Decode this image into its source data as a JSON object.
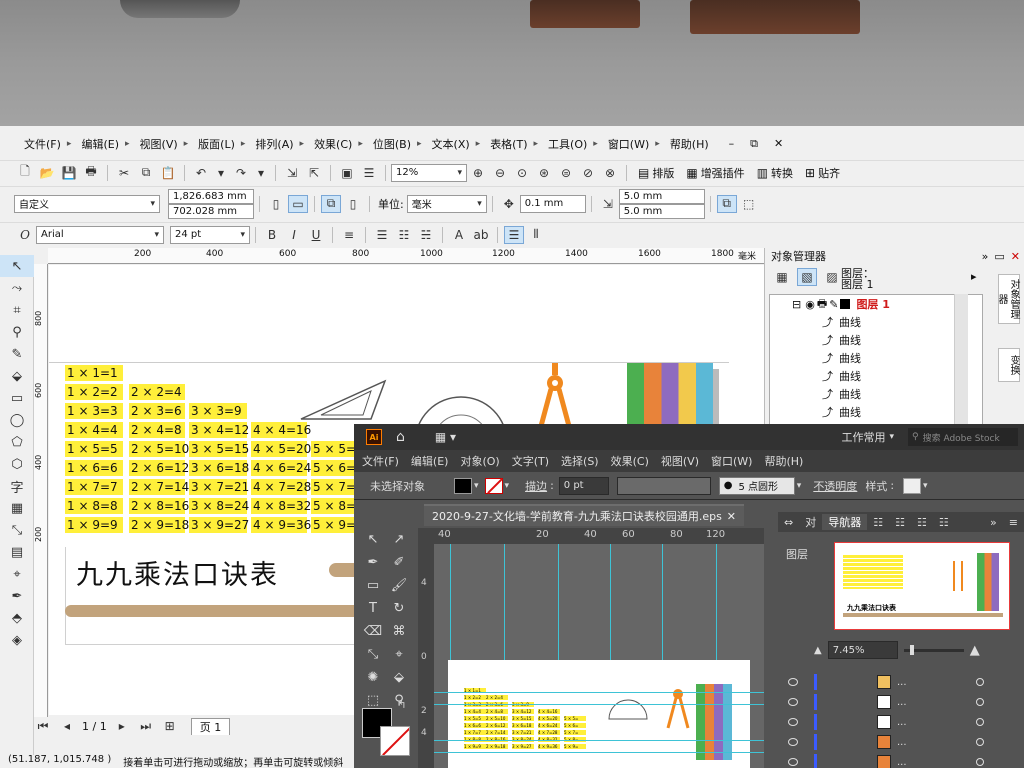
{
  "corel": {
    "menu": [
      "文件(F)",
      "编辑(E)",
      "视图(V)",
      "版面(L)",
      "排列(A)",
      "效果(C)",
      "位图(B)",
      "文本(X)",
      "表格(T)",
      "工具(O)",
      "窗口(W)",
      "帮助(H)"
    ],
    "window_controls": [
      "–",
      "⧉",
      "✕"
    ],
    "zoom": "12%",
    "toolbar_buttons": {
      "layout": "排版",
      "plugin": "增强插件",
      "convert": "转换",
      "together": "贴齐"
    },
    "page_preset": "自定义",
    "width": "1,826.683 mm",
    "height": "702.028 mm",
    "unit_label": "单位:",
    "unit": "毫米",
    "nudge": "0.1 mm",
    "dup_x": "5.0 mm",
    "dup_y": "5.0 mm",
    "font": "Arial",
    "font_size": "24 pt",
    "hruler_unit": "毫米",
    "hruler_ticks": [
      "200",
      "400",
      "600",
      "800",
      "1000",
      "1200",
      "1400",
      "1600",
      "1800"
    ],
    "vruler_ticks": [
      "800",
      "600",
      "400",
      "200"
    ],
    "page_nav": {
      "position": "1 / 1",
      "tab": "页 1"
    },
    "status": {
      "coords": "(51.187, 1,015.748 )",
      "hint": "接着单击可进行拖动或缩放；再单击可旋转或倾斜"
    },
    "object_manager": {
      "title": "对象管理器",
      "layer_label": "图层：",
      "layer_name": "图层 1",
      "layer_header": "图层 1",
      "items": [
        "曲线",
        "曲线",
        "曲线",
        "曲线",
        "曲线",
        "曲线"
      ],
      "side_tab": "对象管理器",
      "side_tab2": "变换"
    }
  },
  "artwork": {
    "table": [
      [
        "1 × 1=1"
      ],
      [
        "1 × 2=2",
        "2 × 2=4"
      ],
      [
        "1 × 3=3",
        "2 × 3=6",
        "3 × 3=9"
      ],
      [
        "1 × 4=4",
        "2 × 4=8",
        "3 × 4=12",
        "4 × 4=16"
      ],
      [
        "1 × 5=5",
        "2 × 5=10",
        "3 × 5=15",
        "4 × 5=20",
        "5 × 5="
      ],
      [
        "1 × 6=6",
        "2 × 6=12",
        "3 × 6=18",
        "4 × 6=24",
        "5 × 6="
      ],
      [
        "1 × 7=7",
        "2 × 7=14",
        "3 × 7=21",
        "4 × 7=28",
        "5 × 7="
      ],
      [
        "1 × 8=8",
        "2 × 8=16",
        "3 × 8=24",
        "4 × 8=32",
        "5 × 8="
      ],
      [
        "1 × 9=9",
        "2 × 9=18",
        "3 × 9=27",
        "4 × 9=36",
        "5 × 9="
      ]
    ],
    "title": "九九乘法口诀表",
    "colors": {
      "highlight": "#ffef3a",
      "shelf": "#c2a37c",
      "compass": "#f0891f"
    }
  },
  "illustrator": {
    "logo": "Ai",
    "workspace": "工作常用",
    "search_placeholder": "搜索 Adobe Stock",
    "menu": [
      "文件(F)",
      "编辑(E)",
      "对象(O)",
      "文字(T)",
      "选择(S)",
      "效果(C)",
      "视图(V)",
      "窗口(W)",
      "帮助(H)"
    ],
    "control": {
      "no_selection": "未选择对象",
      "stroke_label": "描边",
      "stroke_value": "0 pt",
      "brush": "5 点圆形",
      "opacity": "不透明度",
      "style": "样式"
    },
    "doc_tab": "2020-9-27-文化墙-学前教育-九九乘法口诀表校园通用.eps",
    "ruler_ticks": [
      "40",
      "20",
      "40",
      "60",
      "80",
      "120"
    ],
    "panels": {
      "tab1": "对",
      "navigator": "导航器",
      "layers": "图层",
      "zoom": "7.45%",
      "mini_title": "九九乘法口诀表"
    },
    "layer_rows": [
      "...",
      "...",
      "...",
      "...",
      "..."
    ]
  }
}
